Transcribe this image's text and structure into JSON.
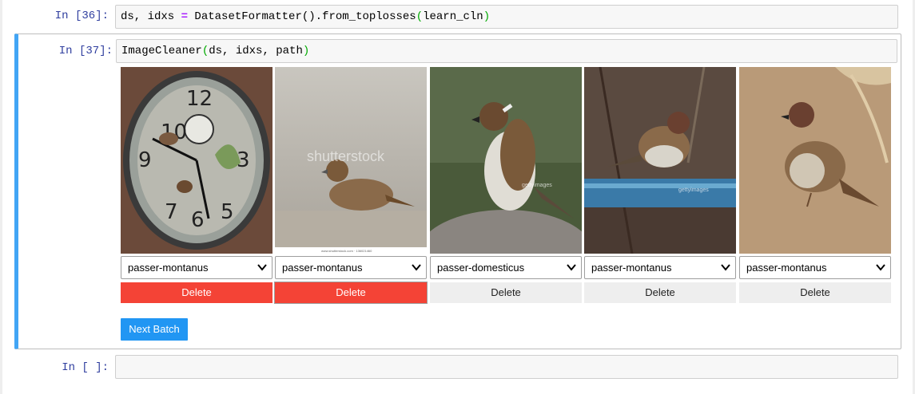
{
  "cells": [
    {
      "prompt": "In [36]:",
      "code": {
        "pre": "ds, idxs ",
        "op": "=",
        "mid": " DatasetFormatter().from_toplosses",
        "p1": "(",
        "arg": "learn_cln",
        "p2": ")"
      }
    },
    {
      "prompt": "In [37]:",
      "code": {
        "pre": "ImageCleaner",
        "p1": "(",
        "arg": "ds, idxs, path",
        "p2": ")"
      }
    },
    {
      "prompt": "In [ ]:",
      "code": ""
    }
  ],
  "widget": {
    "tiles": [
      {
        "label": "passer-montanus",
        "delete_label": "Delete",
        "delete_state": "danger"
      },
      {
        "label": "passer-montanus",
        "delete_label": "Delete",
        "delete_state": "danger"
      },
      {
        "label": "passer-domesticus",
        "delete_label": "Delete",
        "delete_state": "normal"
      },
      {
        "label": "passer-montanus",
        "delete_label": "Delete",
        "delete_state": "normal"
      },
      {
        "label": "passer-montanus",
        "delete_label": "Delete",
        "delete_state": "normal"
      }
    ],
    "next_batch_label": "Next Batch",
    "watermarks": {
      "shutterstock": "shutterstock",
      "shutterstock_id": "www.shutterstock.com · 136021460",
      "gettyimages": "gettyimages"
    }
  },
  "colors": {
    "accent": "#42a5f5",
    "danger": "#f44336",
    "primary": "#2196f3",
    "prompt": "#303f9f"
  }
}
